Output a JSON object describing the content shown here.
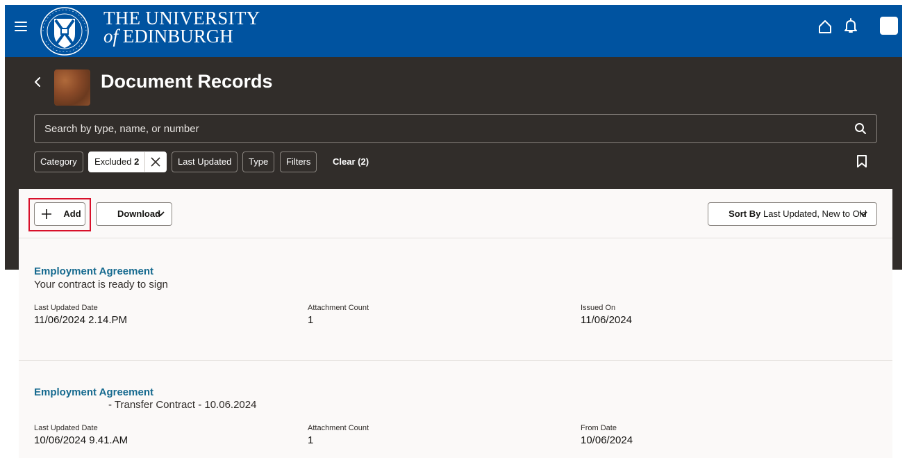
{
  "header": {
    "brand_line1": "THE UNIVERSITY",
    "brand_of": "of",
    "brand_line2": "EDINBURGH",
    "icons": [
      "menu-icon",
      "university-crest",
      "home-icon",
      "bell-icon",
      "user-avatar"
    ]
  },
  "page": {
    "title": "Document Records"
  },
  "search": {
    "placeholder": "Search by type, name, or number"
  },
  "filters": {
    "chips": [
      {
        "label": "Category"
      },
      {
        "label": "Excluded",
        "count": "2"
      },
      {
        "label": "Last Updated"
      },
      {
        "label": "Type"
      },
      {
        "label": "Filters"
      }
    ],
    "clear_label": "Clear (2)"
  },
  "toolbar": {
    "add_label": "Add",
    "download_label": "Download",
    "sort_prefix": "Sort By",
    "sort_value": "Last Updated, New to Old"
  },
  "records": [
    {
      "title": "Employment Agreement",
      "subtitle": "Your contract is ready to sign",
      "fields": [
        {
          "label": "Last Updated Date",
          "value": "11/06/2024 2.14.PM"
        },
        {
          "label": "Attachment Count",
          "value": "1"
        },
        {
          "label": "Issued On",
          "value": "11/06/2024"
        }
      ]
    },
    {
      "title": "Employment Agreement",
      "subtitle": "- Transfer Contract - 10.06.2024",
      "fields": [
        {
          "label": "Last Updated Date",
          "value": "10/06/2024 9.41.AM"
        },
        {
          "label": "Attachment Count",
          "value": "1"
        },
        {
          "label": "From Date",
          "value": "10/06/2024"
        }
      ]
    }
  ],
  "colors": {
    "header_blue": "#0053a0",
    "dark_band": "#312d2a",
    "link_teal": "#166a8f",
    "highlight_red": "#d8102a"
  }
}
